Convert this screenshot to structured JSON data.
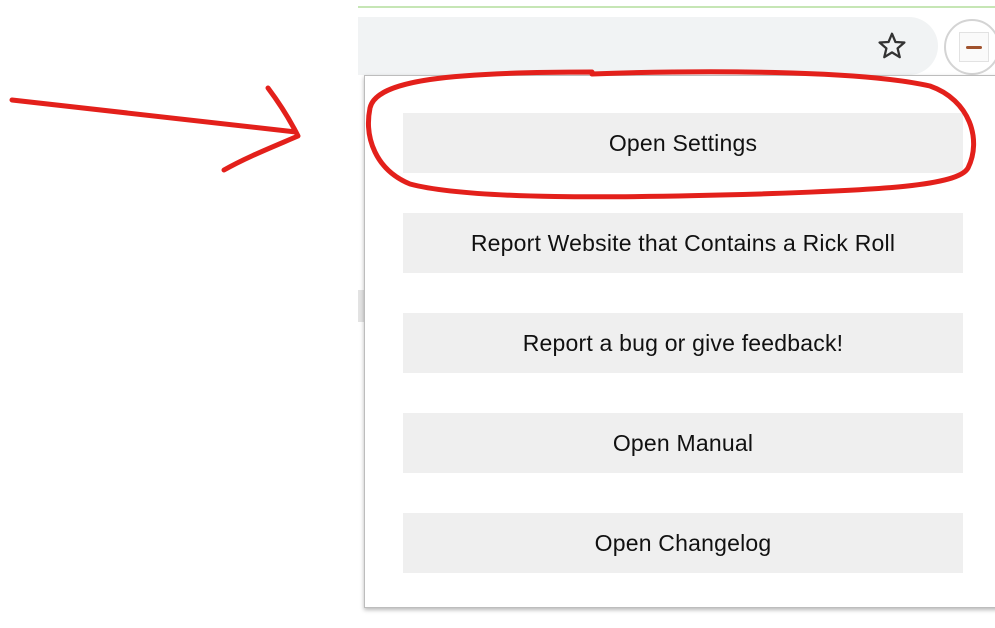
{
  "browser": {
    "bookmark_icon": "star-outline-icon",
    "extension_icon": "extension-icon"
  },
  "popup": {
    "buttons": [
      {
        "label": "Open Settings"
      },
      {
        "label": "Report Website that Contains a Rick Roll"
      },
      {
        "label": "Report a bug or give feedback!"
      },
      {
        "label": "Open Manual"
      },
      {
        "label": "Open Changelog"
      }
    ]
  },
  "annotation": {
    "color": "#e3201b",
    "shapes": [
      "arrow-icon",
      "circle-highlight"
    ]
  }
}
